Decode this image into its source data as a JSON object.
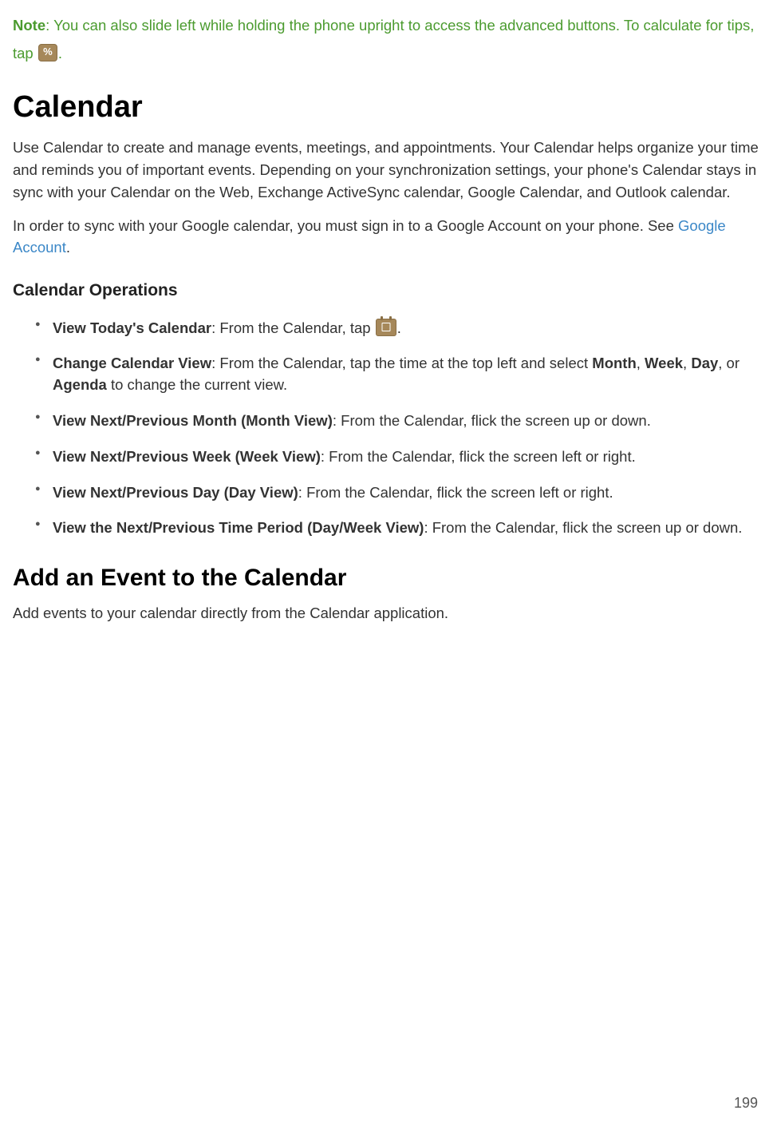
{
  "note": {
    "label": "Note",
    "text_before_icon": ": You can also slide left while holding the phone upright to access the advanced buttons. To calculate for tips, tap ",
    "text_after_icon": "."
  },
  "heading_calendar": "Calendar",
  "calendar_intro": "Use Calendar to create and manage events, meetings, and appointments. Your Calendar helps organize your time and reminds you of important events. Depending on your synchronization settings, your phone's Calendar stays in sync with your Calendar on the Web, Exchange ActiveSync calendar, Google Calendar, and Outlook calendar.",
  "sync_prefix": "In order to sync with your Google calendar, you must sign in to a Google Account on your phone. See ",
  "sync_link": "Google Account",
  "sync_suffix": ".",
  "ops_heading": "Calendar Operations",
  "ops": {
    "today": {
      "label": "View Today's Calendar",
      "text_before": ": From the Calendar, tap ",
      "text_after": "."
    },
    "change_view": {
      "label": "Change Calendar View",
      "pre": ": From the Calendar, tap the time at the top left and select ",
      "month": "Month",
      "sep1": ", ",
      "week": "Week",
      "sep2": ", ",
      "day": "Day",
      "sep3": ", or ",
      "agenda": "Agenda",
      "post": " to change the current view."
    },
    "month": {
      "label": "View Next/Previous Month (Month View)",
      "text": ": From the Calendar, flick the screen up or down."
    },
    "week": {
      "label": "View Next/Previous Week (Week View)",
      "text": ": From the Calendar, flick the screen left or right."
    },
    "dayv": {
      "label": "View Next/Previous Day (Day View)",
      "text": ": From the Calendar, flick the screen left or right."
    },
    "period": {
      "label": "View the Next/Previous Time Period (Day/Week View)",
      "text": ": From the Calendar, flick the screen up or down."
    }
  },
  "heading_add_event": "Add an Event to the Calendar",
  "add_event_intro": "Add events to your calendar directly from the Calendar application.",
  "page_number": "199"
}
